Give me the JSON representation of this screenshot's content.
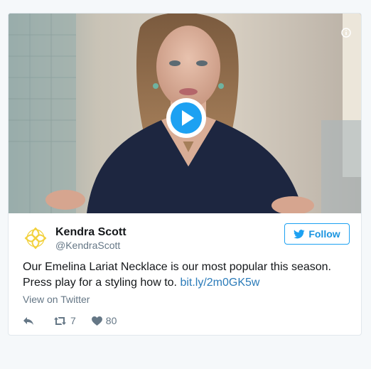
{
  "tweet": {
    "author_name": "Kendra Scott",
    "author_handle": "@KendraScott",
    "follow_label": "Follow",
    "text": "Our Emelina Lariat Necklace is our most popular this season. Press play for a styling how to.",
    "link": "bit.ly/2m0GK5w",
    "view_on_twitter": "View on Twitter",
    "retweet_count": "7",
    "like_count": "80"
  },
  "icons": {
    "info": "info-icon",
    "play": "play-icon",
    "logo": "kendra-scott-logo",
    "twitter_bird": "twitter-bird-icon",
    "reply": "reply-icon",
    "retweet": "retweet-icon",
    "like": "heart-icon"
  },
  "colors": {
    "accent": "#1da1f2",
    "link": "#2b7bb9",
    "logo_yellow": "#f2d13c",
    "muted": "#657786"
  }
}
